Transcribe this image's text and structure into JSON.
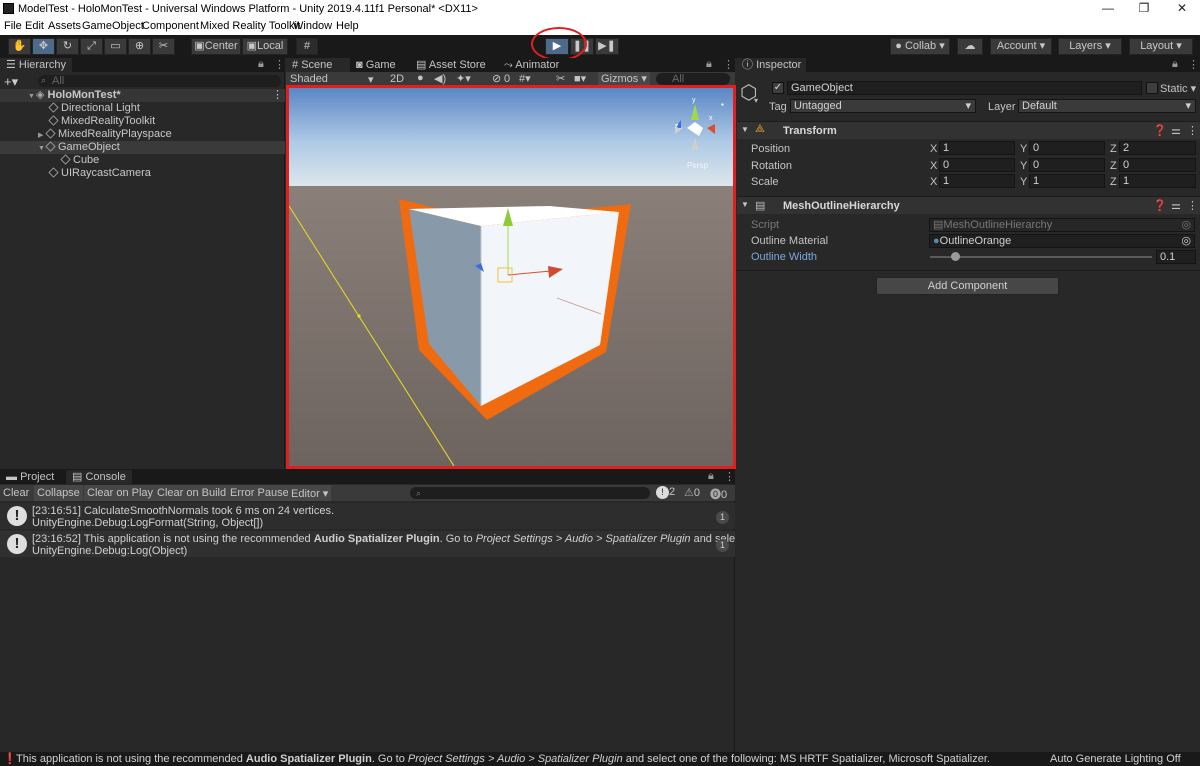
{
  "window": {
    "title": "ModelTest - HoloMonTest - Universal Windows Platform - Unity 2019.4.11f1 Personal* <DX11>",
    "minimize": "—",
    "restore": "❐",
    "close": "✕"
  },
  "menu": [
    "File",
    "Edit",
    "Assets",
    "GameObject",
    "Component",
    "Mixed Reality Toolkit",
    "Window",
    "Help"
  ],
  "toolbar": {
    "pivot": "Center",
    "space": "Local",
    "collab": "Collab",
    "account": "Account",
    "layers": "Layers",
    "layout": "Layout"
  },
  "hierarchy": {
    "tab": "Hierarchy",
    "search_placeholder": "All",
    "scene": "HoloMonTest*",
    "items": [
      "Directional Light",
      "MixedRealityToolkit",
      "MixedRealityPlayspace",
      "GameObject",
      "Cube",
      "UIRaycastCamera"
    ]
  },
  "scene": {
    "tabs": [
      "Scene",
      "Game",
      "Asset Store",
      "Animator"
    ],
    "shading": "Shaded",
    "mode2d": "2D",
    "fx_count": "0",
    "gizmos": "Gizmos",
    "search_placeholder": "All",
    "view_label": "Persp",
    "accent_border": "#e02020",
    "outline_color": "#f06a10"
  },
  "console": {
    "tabs": [
      "Project",
      "Console"
    ],
    "buttons": [
      "Clear",
      "Collapse",
      "Clear on Play",
      "Clear on Build",
      "Error Pause",
      "Editor"
    ],
    "counts": {
      "info": "2",
      "warn": "0",
      "error": "0"
    },
    "logs": [
      {
        "line1": "[23:16:51] CalculateSmoothNormals took 6 ms on 24 vertices.",
        "line2": "UnityEngine.Debug:LogFormat(String, Object[])",
        "count": "1"
      },
      {
        "line1_prefix": "[23:16:52] This application is not using the recommended ",
        "line1_bold": "Audio Spatializer Plugin",
        "line1_mid": ". Go to ",
        "line1_italic": "Project Settings > Audio > Spatializer Plugin",
        "line1_suffix": " and select one of",
        "line2": "UnityEngine.Debug:Log(Object)",
        "count": "1"
      }
    ]
  },
  "inspector": {
    "tab": "Inspector",
    "object_name": "GameObject",
    "static": "Static",
    "tag_label": "Tag",
    "tag": "Untagged",
    "layer_label": "Layer",
    "layer": "Default",
    "transform": {
      "title": "Transform",
      "position": {
        "label": "Position",
        "x": "1",
        "y": "0",
        "z": "2"
      },
      "rotation": {
        "label": "Rotation",
        "x": "0",
        "y": "0",
        "z": "0"
      },
      "scale": {
        "label": "Scale",
        "x": "1",
        "y": "1",
        "z": "1"
      }
    },
    "mesh_outline": {
      "title": "MeshOutlineHierarchy",
      "script_label": "Script",
      "script": "MeshOutlineHierarchy",
      "material_label": "Outline Material",
      "material": "OutlineOrange",
      "width_label": "Outline Width",
      "width": "0.1"
    },
    "add_component": "Add Component"
  },
  "statusbar": {
    "prefix": "This application is not using the recommended ",
    "bold": "Audio Spatializer Plugin",
    "mid": ". Go to ",
    "italic": "Project Settings > Audio > Spatializer Plugin",
    "suffix": " and select one of the following: MS HRTF Spatializer, Microsoft Spatializer.",
    "right": "Auto Generate Lighting Off"
  }
}
